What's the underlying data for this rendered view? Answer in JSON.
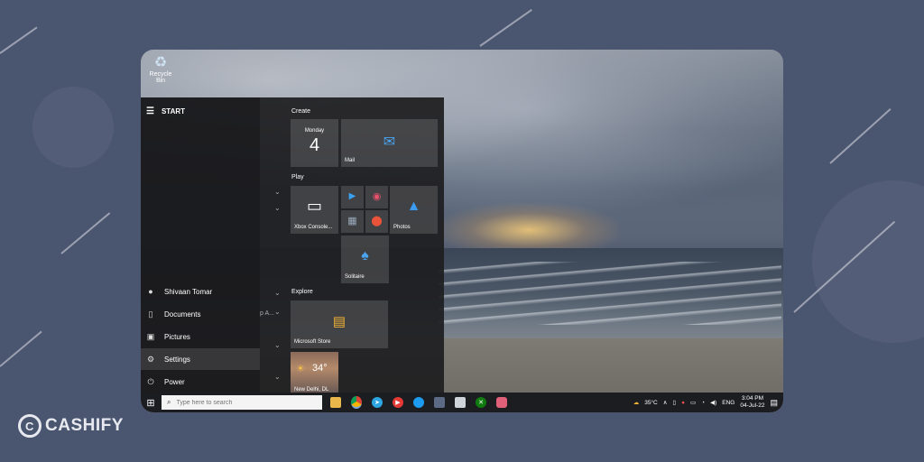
{
  "desktop": {
    "recycle_bin_label": "Recycle Bin"
  },
  "start_menu": {
    "header": "START",
    "rail_items": [
      {
        "label": "Shivaan Tomar",
        "icon": "user-avatar-icon"
      },
      {
        "label": "Documents",
        "icon": "document-icon"
      },
      {
        "label": "Pictures",
        "icon": "picture-icon"
      },
      {
        "label": "Settings",
        "icon": "gear-icon"
      },
      {
        "label": "Power",
        "icon": "power-icon"
      }
    ],
    "applist_fragment": "p A...",
    "groups": {
      "create": "Create",
      "play": "Play",
      "explore": "Explore"
    },
    "tiles": {
      "calendar_day": "Monday",
      "calendar_date": "4",
      "mail": "Mail",
      "xbox": "Xbox Console...",
      "photos": "Photos",
      "solitaire": "Solitaire",
      "store": "Microsoft Store",
      "weather_temp": "34°",
      "weather_city": "New Delhi, DL"
    }
  },
  "taskbar": {
    "search_placeholder": "Type here to search",
    "pinned": [
      "file-explorer-icon",
      "chrome-icon",
      "telegram-icon",
      "youtube-music-icon",
      "twitter-icon",
      "camera-icon",
      "eraser-icon",
      "xbox-icon",
      "snip-icon"
    ],
    "weather_tray": "35°C",
    "language": "ENG",
    "time": "3:04 PM",
    "date": "04-Jul-22"
  },
  "brand": {
    "name": "CASHIFY"
  },
  "colors": {
    "page_bg": "#4a5570",
    "taskbar": "#1c1d21",
    "start_bg": "#1e1e20"
  }
}
